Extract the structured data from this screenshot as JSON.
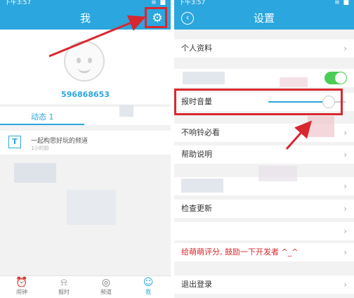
{
  "left": {
    "status_time": "下午3:57",
    "status_icons": "≡ ■",
    "title": "我",
    "user_id": "596868653",
    "dynamics_label": "动态 1",
    "post_title": "一起构思好玩的频道",
    "post_sub": "1小时前",
    "tabs": [
      {
        "label": "闹钟",
        "icon": "⏰"
      },
      {
        "label": "报时",
        "icon": "⍾"
      },
      {
        "label": "频道",
        "icon": "◎"
      },
      {
        "label": "我",
        "icon": "☺"
      }
    ]
  },
  "right": {
    "status_time": "下午3:57",
    "status_icons": "≡ ■",
    "title": "设置",
    "rows": [
      {
        "label": "个人资料",
        "kind": "chevron"
      },
      {
        "label": "",
        "kind": "toggle",
        "toggle_on": true
      },
      {
        "label": "报时音量",
        "kind": "slider",
        "volume_fraction": 0.78
      },
      {
        "label": "不响铃必看",
        "kind": "chevron"
      },
      {
        "label": "帮助说明",
        "kind": "chevron"
      },
      {
        "label": "",
        "kind": "chevron"
      },
      {
        "label": "检查更新",
        "kind": "chevron"
      },
      {
        "label": "",
        "kind": "chevron"
      },
      {
        "label": "给萌萌评分, 鼓励一下开发者 ^_^",
        "kind": "chevron",
        "color": "#d8282f"
      },
      {
        "label": "退出登录",
        "kind": "chevron"
      }
    ],
    "chevron": "›"
  },
  "colors": {
    "accent": "#2ba6de",
    "highlight": "#d8282f",
    "toggle_on": "#4ccd58"
  }
}
